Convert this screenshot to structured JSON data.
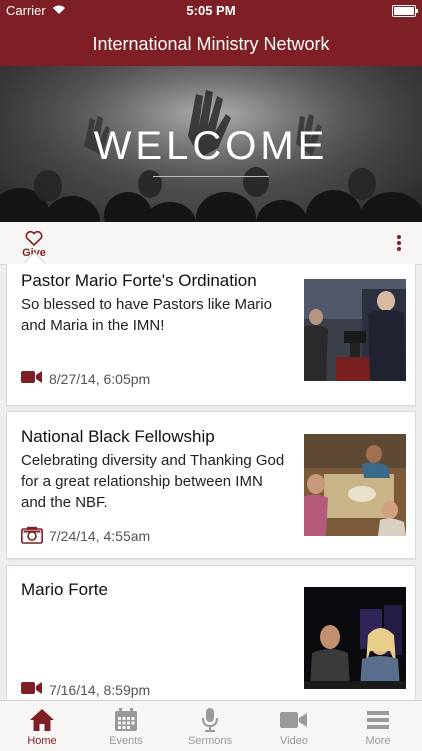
{
  "status_bar": {
    "carrier": "Carrier",
    "time": "5:05 PM"
  },
  "nav": {
    "title": "International Ministry Network"
  },
  "hero": {
    "text": "WELCOME"
  },
  "toolbar": {
    "give_label": "Give"
  },
  "posts": [
    {
      "title": "Pastor Mario Forte's Ordination",
      "description": "So blessed to have Pastors like Mario and Maria in the IMN!",
      "media_icon": "video-camera-icon",
      "date": "8/27/14, 6:05pm"
    },
    {
      "title": "National Black Fellowship",
      "description": "Celebrating diversity and Thanking God for a great relationship between IMN and the NBF.",
      "media_icon": "photo-camera-icon",
      "date": "7/24/14, 4:55am"
    },
    {
      "title": "Mario Forte",
      "description": "",
      "media_icon": "video-camera-icon",
      "date": "7/16/14, 8:59pm"
    }
  ],
  "tabs": [
    {
      "label": "Home",
      "icon": "home-icon"
    },
    {
      "label": "Events",
      "icon": "calendar-icon"
    },
    {
      "label": "Sermons",
      "icon": "microphone-icon"
    },
    {
      "label": "Video",
      "icon": "video-camera-icon"
    },
    {
      "label": "More",
      "icon": "menu-icon"
    }
  ],
  "colors": {
    "brand": "#7e1f25",
    "inactive_tab": "#9c9a98",
    "background": "#efeeed"
  }
}
